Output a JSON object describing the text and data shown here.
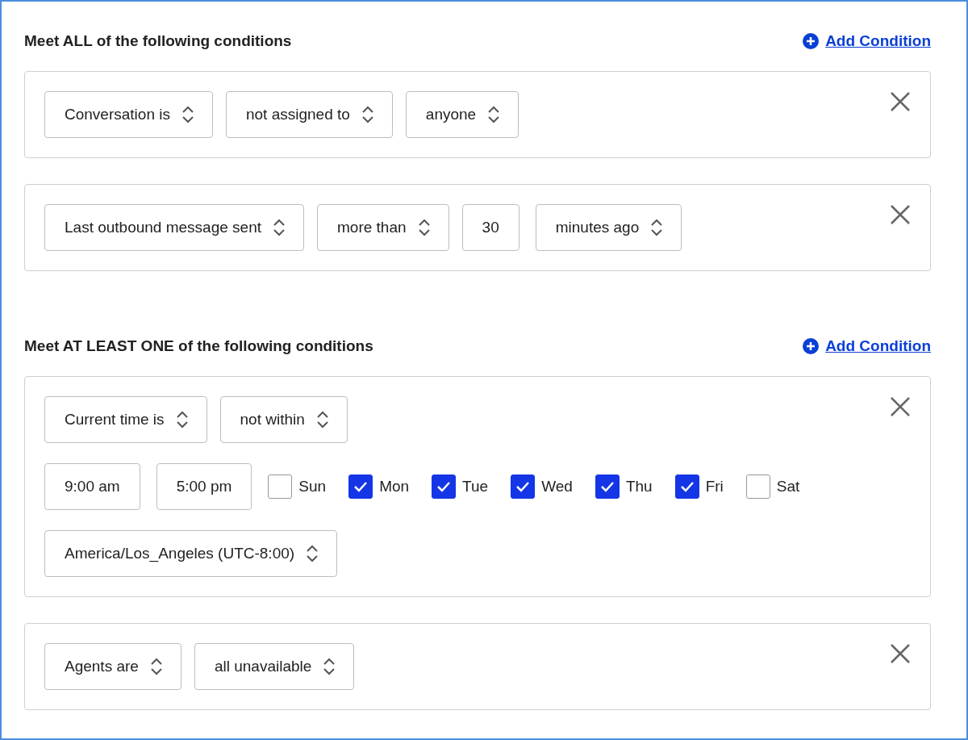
{
  "sections": [
    {
      "heading": "Meet ALL of the following conditions",
      "add_label": "Add Condition",
      "conditions": [
        {
          "rows": [
            [
              {
                "kind": "select",
                "value": "Conversation is"
              },
              {
                "kind": "select",
                "value": "not assigned to"
              },
              {
                "kind": "select",
                "value": "anyone"
              }
            ]
          ]
        },
        {
          "rows": [
            [
              {
                "kind": "select",
                "value": "Last outbound message sent"
              },
              {
                "kind": "select",
                "value": "more than"
              },
              {
                "kind": "input",
                "value": "30"
              },
              {
                "kind": "select",
                "value": "minutes ago"
              }
            ]
          ]
        }
      ]
    },
    {
      "heading": "Meet AT LEAST ONE of the following conditions",
      "add_label": "Add Condition",
      "conditions": [
        {
          "rows": [
            [
              {
                "kind": "select",
                "value": "Current time is"
              },
              {
                "kind": "select",
                "value": "not within"
              }
            ],
            [
              {
                "kind": "input",
                "value": "9:00 am"
              },
              {
                "kind": "input",
                "value": "5:00 pm"
              },
              {
                "kind": "day",
                "label": "Sun",
                "checked": false
              },
              {
                "kind": "day",
                "label": "Mon",
                "checked": true
              },
              {
                "kind": "day",
                "label": "Tue",
                "checked": true
              },
              {
                "kind": "day",
                "label": "Wed",
                "checked": true
              },
              {
                "kind": "day",
                "label": "Thu",
                "checked": true
              },
              {
                "kind": "day",
                "label": "Fri",
                "checked": true
              },
              {
                "kind": "day",
                "label": "Sat",
                "checked": false
              }
            ],
            [
              {
                "kind": "select",
                "value": "America/Los_Angeles (UTC-8:00)"
              }
            ]
          ]
        },
        {
          "rows": [
            [
              {
                "kind": "select",
                "value": "Agents are"
              },
              {
                "kind": "select",
                "value": "all unavailable"
              }
            ]
          ]
        }
      ]
    }
  ]
}
